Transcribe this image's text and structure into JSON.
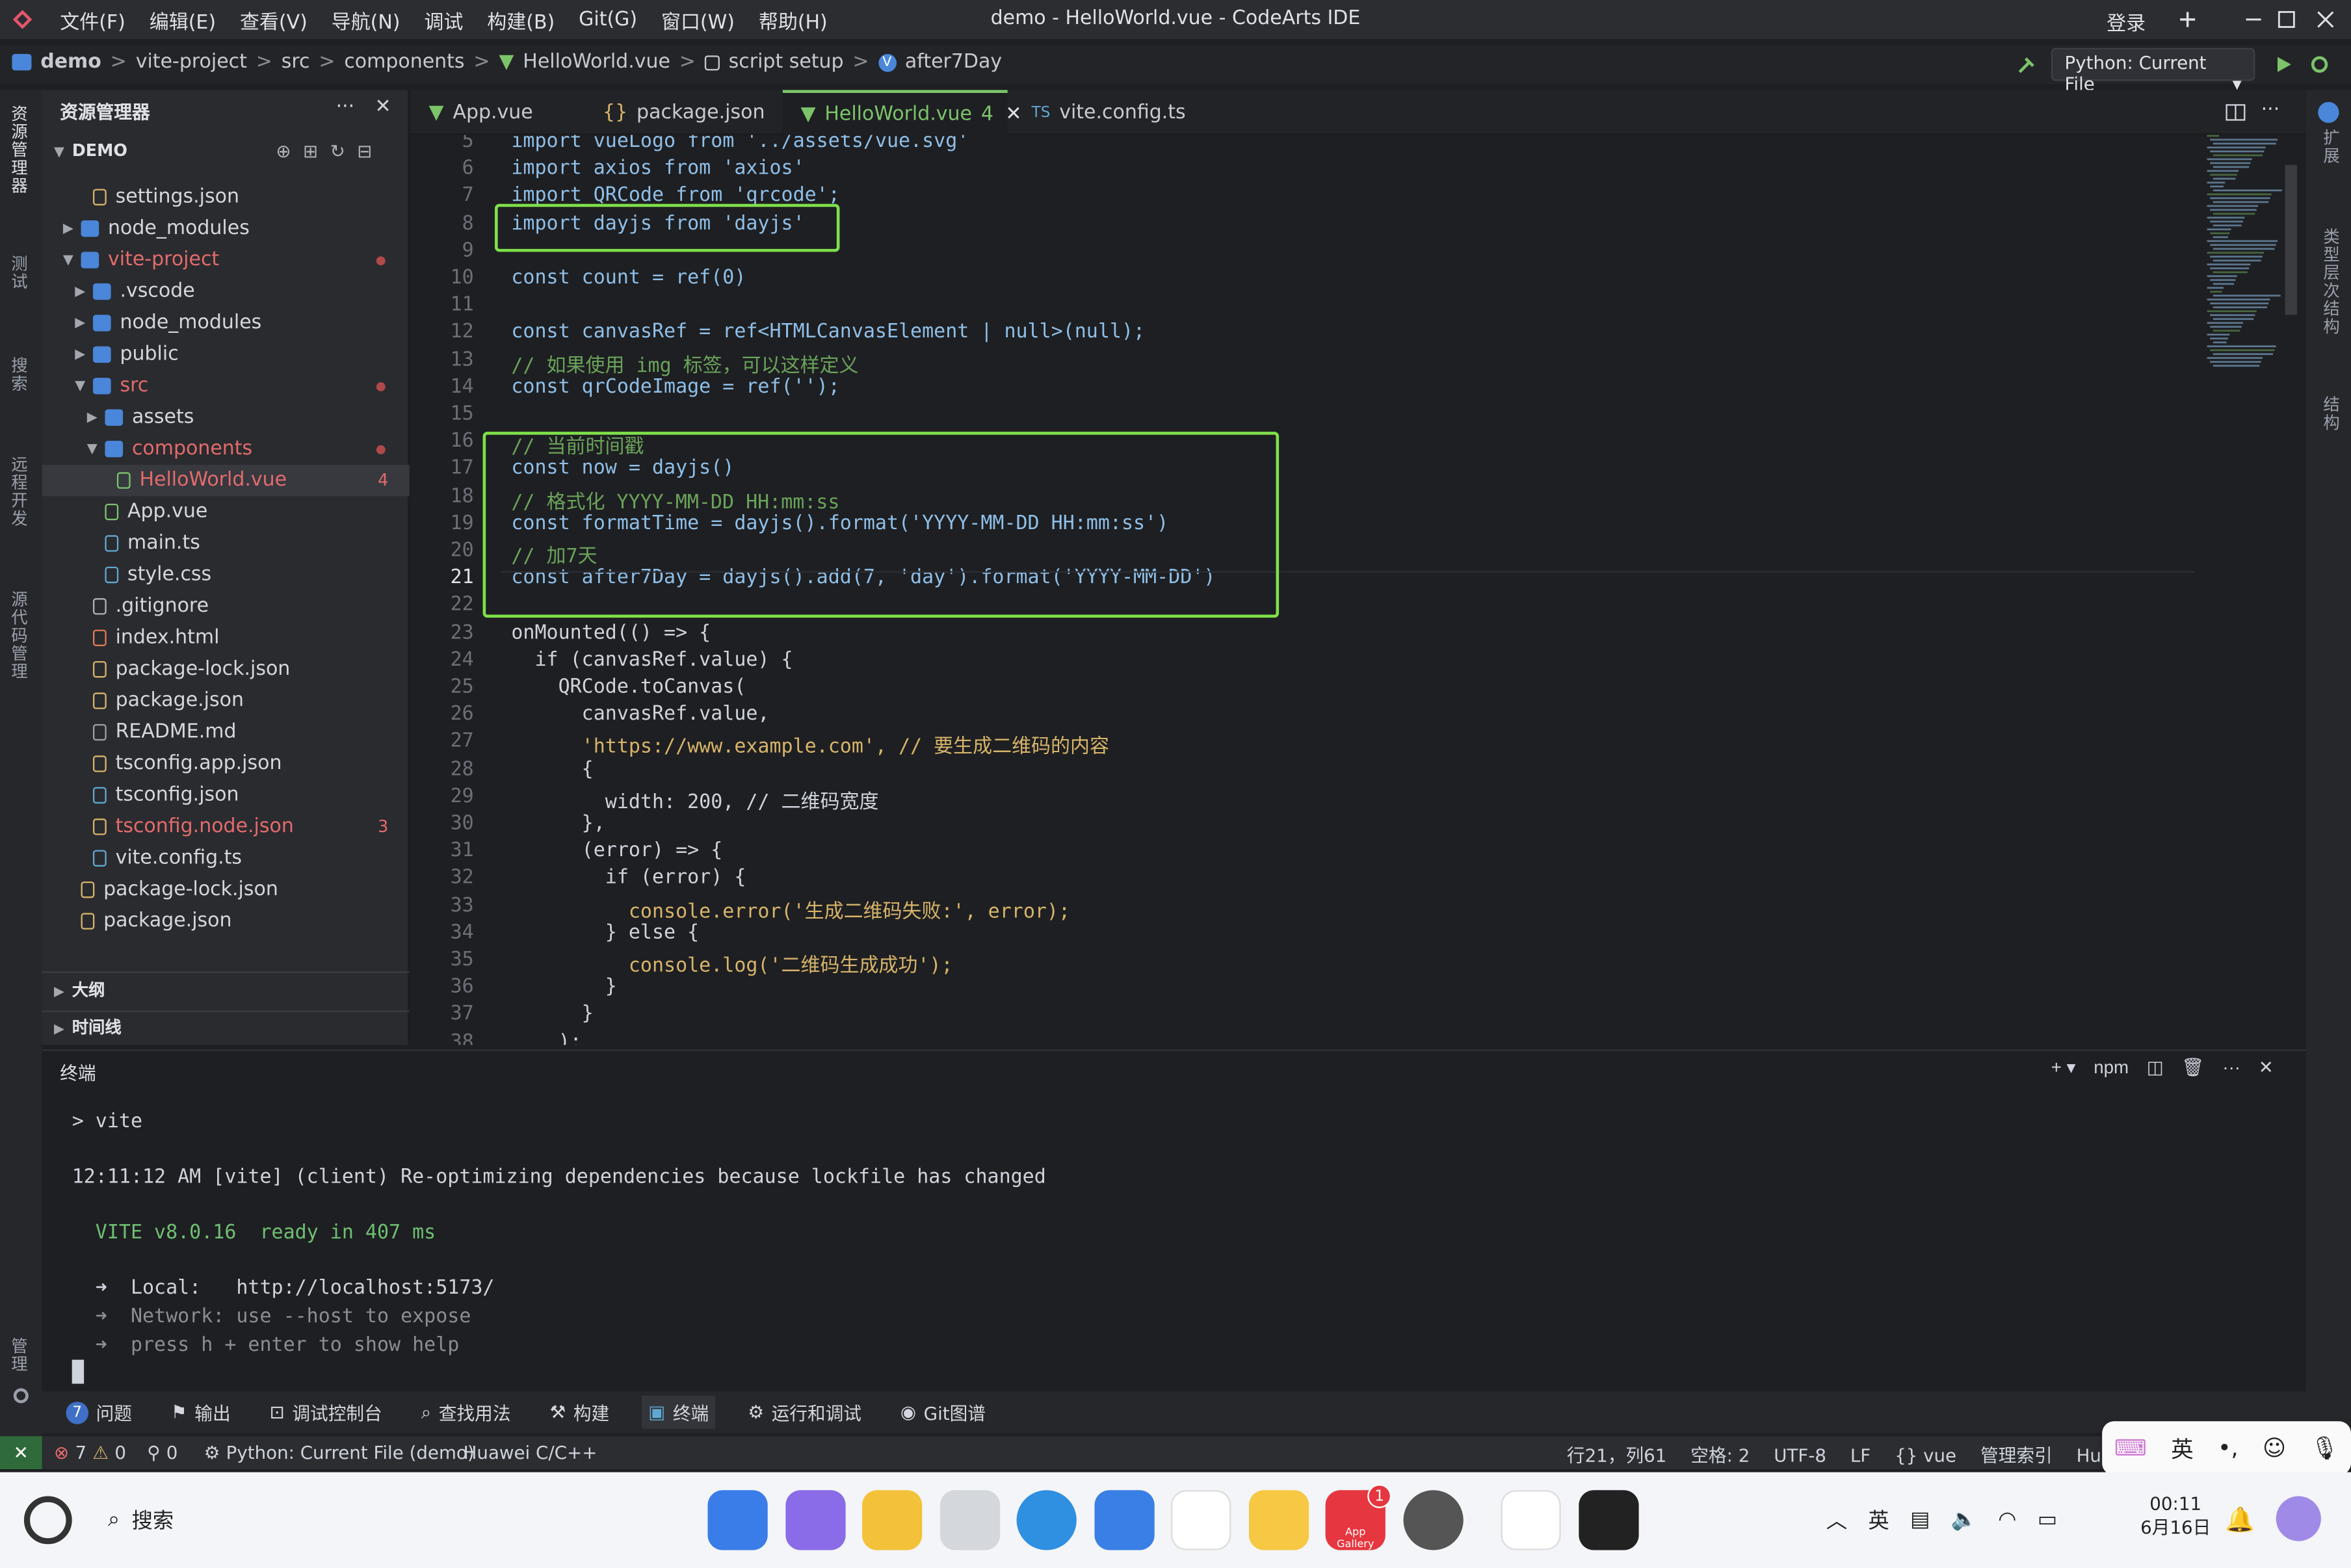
{
  "titlebar": {
    "menus": [
      "文件(F)",
      "编辑(E)",
      "查看(V)",
      "导航(N)",
      "调试",
      "构建(B)",
      "Git(G)",
      "窗口(W)",
      "帮助(H)"
    ],
    "title": "demo - HelloWorld.vue - CodeArts IDE",
    "login": "登录"
  },
  "breadcrumb": [
    "demo",
    "vite-project",
    "src",
    "components",
    "HelloWorld.vue",
    "script setup",
    "after7Day"
  ],
  "run_config": "Python: Current File",
  "activity": [
    "资源管理器",
    "测试",
    "搜索",
    "远程开发",
    "源代码管理",
    "管理"
  ],
  "right_activity": [
    "扩展",
    "类型层次结构",
    "结构"
  ],
  "sidebar": {
    "title": "资源管理器",
    "section": "DEMO",
    "items": [
      {
        "label": "settings.json",
        "kind": "json",
        "depth": 2
      },
      {
        "label": "node_modules",
        "kind": "folder",
        "depth": 1
      },
      {
        "label": "vite-project",
        "kind": "folder-open",
        "depth": 1
      },
      {
        "label": ".vscode",
        "kind": "folder",
        "depth": 2
      },
      {
        "label": "node_modules",
        "kind": "folder",
        "depth": 2
      },
      {
        "label": "public",
        "kind": "folder",
        "depth": 2
      },
      {
        "label": "src",
        "kind": "folder-open",
        "depth": 2
      },
      {
        "label": "assets",
        "kind": "folder",
        "depth": 3
      },
      {
        "label": "components",
        "kind": "folder-open",
        "depth": 3
      },
      {
        "label": "HelloWorld.vue",
        "kind": "vue",
        "depth": 4,
        "badge": "4"
      },
      {
        "label": "App.vue",
        "kind": "vue",
        "depth": 3
      },
      {
        "label": "main.ts",
        "kind": "ts",
        "depth": 3
      },
      {
        "label": "style.css",
        "kind": "css",
        "depth": 3
      },
      {
        "label": ".gitignore",
        "kind": "git",
        "depth": 2
      },
      {
        "label": "index.html",
        "kind": "html",
        "depth": 2
      },
      {
        "label": "package-lock.json",
        "kind": "json",
        "depth": 2
      },
      {
        "label": "package.json",
        "kind": "json",
        "depth": 2
      },
      {
        "label": "README.md",
        "kind": "info",
        "depth": 2
      },
      {
        "label": "tsconfig.app.json",
        "kind": "json",
        "depth": 2
      },
      {
        "label": "tsconfig.json",
        "kind": "tsconfig",
        "depth": 2
      },
      {
        "label": "tsconfig.node.json",
        "kind": "json",
        "depth": 2,
        "badge": "3"
      },
      {
        "label": "vite.config.ts",
        "kind": "ts",
        "depth": 2
      },
      {
        "label": "package-lock.json",
        "kind": "json",
        "depth": 1
      },
      {
        "label": "package.json",
        "kind": "json",
        "depth": 1
      }
    ],
    "outline": "大纲",
    "timeline": "时间线"
  },
  "tabs": [
    {
      "label": "App.vue",
      "icon": "vue-icon"
    },
    {
      "label": "package.json",
      "icon": "json-icon"
    },
    {
      "label": "HelloWorld.vue",
      "badge": "4",
      "icon": "vue-icon",
      "active": true
    },
    {
      "label": "vite.config.ts",
      "icon": "ts-icon"
    }
  ],
  "editor": {
    "current_line": 21,
    "lines": [
      {
        "n": "5",
        "t": "import vueLogo from '../assets/vue.svg'"
      },
      {
        "n": "6",
        "t": "import axios from 'axios'"
      },
      {
        "n": "7",
        "t": "import QRCode from 'qrcode';"
      },
      {
        "n": "8",
        "t": "import dayjs from 'dayjs'"
      },
      {
        "n": "9",
        "t": ""
      },
      {
        "n": "10",
        "t": "const count = ref(0)"
      },
      {
        "n": "11",
        "t": ""
      },
      {
        "n": "12",
        "t": "const canvasRef = ref<HTMLCanvasElement | null>(null);"
      },
      {
        "n": "13",
        "t": "// 如果使用 img 标签，可以这样定义"
      },
      {
        "n": "14",
        "t": "const qrCodeImage = ref('');"
      },
      {
        "n": "15",
        "t": ""
      },
      {
        "n": "16",
        "t": "// 当前时间戳"
      },
      {
        "n": "17",
        "t": "const now = dayjs()"
      },
      {
        "n": "18",
        "t": "// 格式化 YYYY-MM-DD HH:mm:ss"
      },
      {
        "n": "19",
        "t": "const formatTime = dayjs().format('YYYY-MM-DD HH:mm:ss')"
      },
      {
        "n": "20",
        "t": "// 加7天"
      },
      {
        "n": "21",
        "t": "const after7Day = dayjs().add(7, 'day').format('YYYY-MM-DD')"
      },
      {
        "n": "22",
        "t": ""
      },
      {
        "n": "23",
        "t": "onMounted(() => {"
      },
      {
        "n": "24",
        "t": "  if (canvasRef.value) {"
      },
      {
        "n": "25",
        "t": "    QRCode.toCanvas("
      },
      {
        "n": "26",
        "t": "      canvasRef.value,"
      },
      {
        "n": "27",
        "t": "      'https://www.example.com', // 要生成二维码的内容"
      },
      {
        "n": "28",
        "t": "      {"
      },
      {
        "n": "29",
        "t": "        width: 200, // 二维码宽度"
      },
      {
        "n": "30",
        "t": "      },"
      },
      {
        "n": "31",
        "t": "      (error) => {"
      },
      {
        "n": "32",
        "t": "        if (error) {"
      },
      {
        "n": "33",
        "t": "          console.error('生成二维码失败:', error);"
      },
      {
        "n": "34",
        "t": "        } else {"
      },
      {
        "n": "35",
        "t": "          console.log('二维码生成成功');"
      },
      {
        "n": "36",
        "t": "        }"
      },
      {
        "n": "37",
        "t": "      }"
      },
      {
        "n": "38",
        "t": "    );"
      }
    ]
  },
  "terminal": {
    "title": "终端",
    "profile": "npm",
    "lines": [
      "> vite",
      "",
      "12:11:12 AM [vite] (client) Re-optimizing dependencies because lockfile has changed",
      "",
      "  VITE v8.0.16  ready in 407 ms",
      "",
      "  ➜  Local:   http://localhost:5173/",
      "  ➜  Network: use --host to expose",
      "  ➜  press h + enter to show help"
    ]
  },
  "panel_tabs": [
    {
      "label": "问题",
      "count": "7"
    },
    {
      "label": "输出"
    },
    {
      "label": "调试控制台"
    },
    {
      "label": "查找用法"
    },
    {
      "label": "构建"
    },
    {
      "label": "终端",
      "active": true
    },
    {
      "label": "运行和调试"
    },
    {
      "label": "Git图谱"
    }
  ],
  "statusbar": {
    "errors": "7",
    "warnings": "0",
    "ports": "0",
    "run": "Python: Current File (demo)",
    "lang_ext": "Huawei C/C++",
    "position": "行21，列61",
    "spaces": "空格: 2",
    "encoding": "UTF-8",
    "eol": "LF",
    "language": "vue",
    "index": "管理索引",
    "trail": "Huawei C"
  },
  "ime": {
    "mode": "英"
  },
  "taskbar": {
    "search": "搜索",
    "app_gallery": "App Gallery",
    "app_gallery_badge": "1",
    "ime": "英",
    "time": "00:11",
    "date": "6月16日"
  },
  "colors": {
    "accent": "#7cc36a",
    "highlight_box": "#7fe04a",
    "error": "#e36b6b"
  }
}
